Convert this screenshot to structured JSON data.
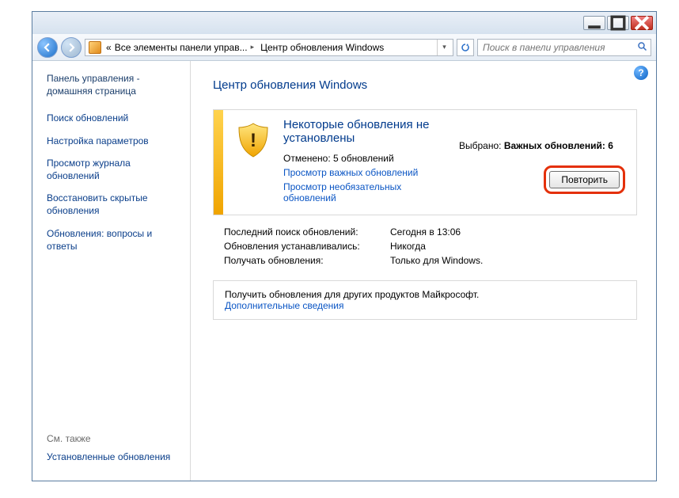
{
  "breadcrumb": {
    "seg1_prefix": "«",
    "seg1": "Все элементы панели управ...",
    "seg2": "Центр обновления Windows"
  },
  "search": {
    "placeholder": "Поиск в панели управления"
  },
  "sidebar": {
    "home": "Панель управления - домашняя страница",
    "links": [
      "Поиск обновлений",
      "Настройка параметров",
      "Просмотр журнала обновлений",
      "Восстановить скрытые обновления",
      "Обновления: вопросы и ответы"
    ],
    "see_also_hdr": "См. также",
    "see_also_link": "Установленные обновления"
  },
  "page": {
    "title": "Центр обновления Windows"
  },
  "status": {
    "title": "Некоторые обновления не установлены",
    "cancelled_label": "Отменено:",
    "cancelled_value": "5 обновлений",
    "link_important": "Просмотр важных обновлений",
    "link_optional": "Просмотр необязательных обновлений",
    "selected_label": "Выбрано:",
    "selected_value": "Важных обновлений: 6",
    "retry": "Повторить"
  },
  "info": {
    "rows": [
      {
        "k": "Последний поиск обновлений:",
        "v": "Сегодня в 13:06"
      },
      {
        "k": "Обновления устанавливались:",
        "v": "Никогда"
      },
      {
        "k": "Получать обновления:",
        "v": "Только для Windows."
      }
    ]
  },
  "promo": {
    "text": "Получить обновления для других продуктов Майкрософт.",
    "link": "Дополнительные сведения"
  }
}
